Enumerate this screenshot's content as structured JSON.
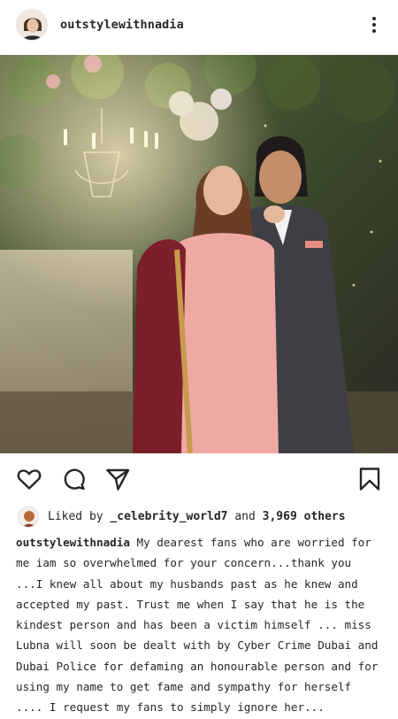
{
  "post": {
    "username": "outstylewithnadia",
    "likes_prefix": "Liked by",
    "likes_user": "_celebrity_world7",
    "likes_joiner": "and",
    "likes_others": "3,969 others",
    "caption_user": "outstylewithnadia",
    "caption_text": "My dearest fans who are worried for me iam so overwhelmed for your concern...thank you ...I knew all about my husbands past as he knew and accepted my past. Trust me when I say that he is the kindest person and has been a victim himself ... miss Lubna will soon be dealt with by Cyber Crime Dubai and Dubai Police  for defaming an honourable person and for using my name to get fame and sympathy for herself .... I request my fans to simply ignore her..."
  },
  "icons": {
    "more": "more-vertical-icon",
    "like": "heart-icon",
    "comment": "comment-icon",
    "share": "send-icon",
    "save": "bookmark-icon"
  }
}
